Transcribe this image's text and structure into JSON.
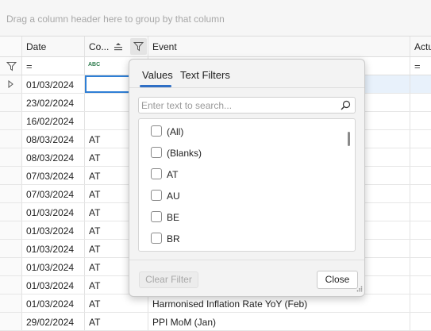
{
  "group_panel": {
    "hint": "Drag a column header here to group by that column"
  },
  "columns": {
    "date": "Date",
    "country": "Co...",
    "event": "Event",
    "actual": "Actu"
  },
  "filter_row": {
    "date_op": "=",
    "country_op": "ABC",
    "actual_op": "="
  },
  "rows": [
    {
      "date": "01/03/2024",
      "country": "",
      "event": ""
    },
    {
      "date": "23/02/2024",
      "country": "",
      "event": ""
    },
    {
      "date": "16/02/2024",
      "country": "",
      "event": ""
    },
    {
      "date": "08/03/2024",
      "country": "AT",
      "event": ""
    },
    {
      "date": "08/03/2024",
      "country": "AT",
      "event": ""
    },
    {
      "date": "07/03/2024",
      "country": "AT",
      "event": ""
    },
    {
      "date": "07/03/2024",
      "country": "AT",
      "event": ""
    },
    {
      "date": "01/03/2024",
      "country": "AT",
      "event": ""
    },
    {
      "date": "01/03/2024",
      "country": "AT",
      "event": ""
    },
    {
      "date": "01/03/2024",
      "country": "AT",
      "event": ""
    },
    {
      "date": "01/03/2024",
      "country": "AT",
      "event": ""
    },
    {
      "date": "01/03/2024",
      "country": "AT",
      "event": ""
    },
    {
      "date": "01/03/2024",
      "country": "AT",
      "event": "Harmonised Inflation Rate YoY (Feb)"
    },
    {
      "date": "29/02/2024",
      "country": "AT",
      "event": "PPI MoM (Jan)"
    }
  ],
  "filter_popup": {
    "tab_values": "Values",
    "tab_text_filters": "Text Filters",
    "search_placeholder": "Enter text to search...",
    "items": [
      "(All)",
      "(Blanks)",
      "AT",
      "AU",
      "BE",
      "BR"
    ],
    "clear_filter": "Clear Filter",
    "close": "Close"
  },
  "colors": {
    "accent": "#2f6fc5",
    "selection": "#2f7fd5"
  }
}
